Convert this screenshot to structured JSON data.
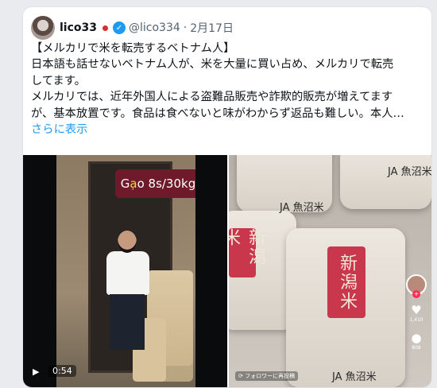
{
  "user": {
    "display_name": "lico33",
    "handle": "@lico334",
    "date": "2月17日"
  },
  "tweet_lines": [
    "【メルカリで米を転売するベトナム人】",
    "日本語も話せないベトナム人が、米を大量に買い占め、メルカリで転売",
    "してます。",
    "メルカリでは、近年外国人による盗難品販売や詐欺的販売が増えてます",
    "が、基本放置です。食品は食べないと味がわからず返品も難しい。本人…"
  ],
  "show_more": "さらに表示",
  "video": {
    "label_prefix": "G",
    "label_highlight": "ạ",
    "label_rest": "o 8s/30kg",
    "play_icon": "▶",
    "duration": "0:54"
  },
  "photo": {
    "brand_text": "JA 魚沼米",
    "stamp_text": "新潟米",
    "likes": "1,410",
    "comments": "808",
    "repost_note": "フォロワーに再投稿"
  }
}
